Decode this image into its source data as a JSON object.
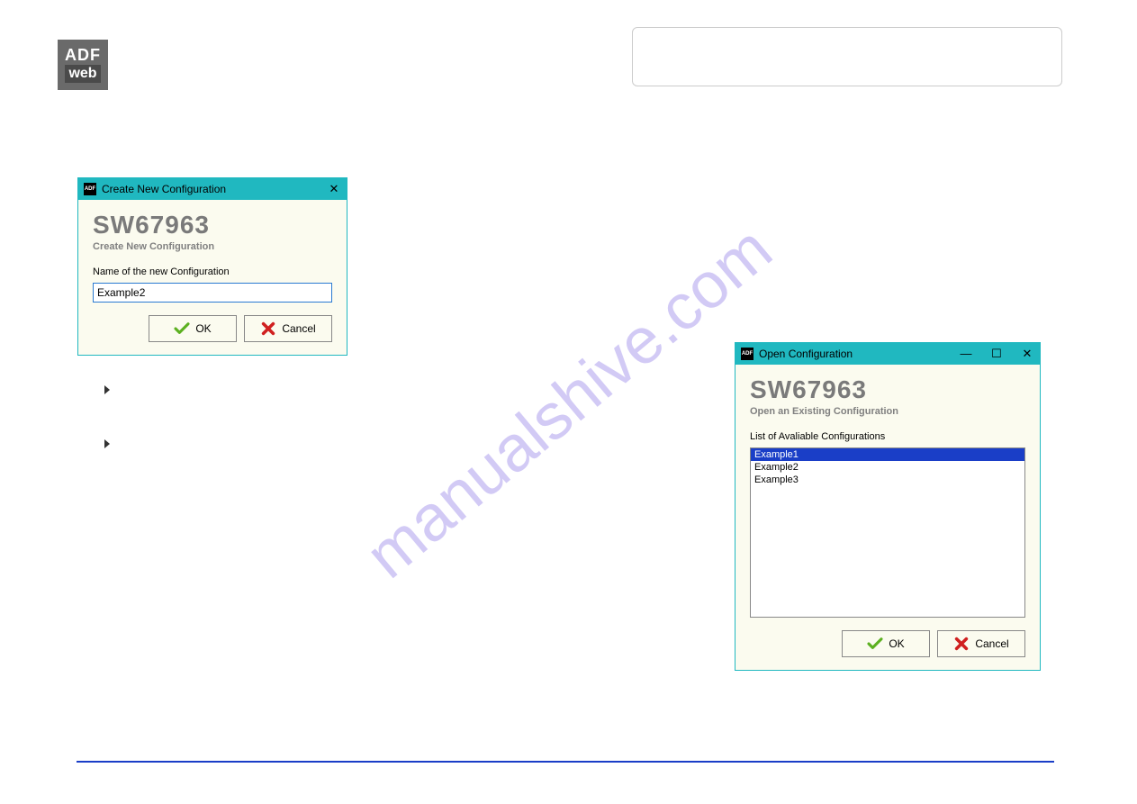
{
  "watermark": "manualshive.com",
  "logo": {
    "line1": "ADF",
    "line2": "web"
  },
  "dialog1": {
    "title": "Create New Configuration",
    "big_title": "SW67963",
    "sub_title": "Create New Configuration",
    "field_label": "Name of the new Configuration",
    "field_value": "Example2",
    "ok_label": "OK",
    "cancel_label": "Cancel"
  },
  "dialog2": {
    "title": "Open Configuration",
    "big_title": "SW67963",
    "sub_title": "Open an Existing Configuration",
    "list_label": "List of Avaliable Configurations",
    "items": [
      "Example1",
      "Example2",
      "Example3"
    ],
    "selected_index": 0,
    "ok_label": "OK",
    "cancel_label": "Cancel"
  }
}
